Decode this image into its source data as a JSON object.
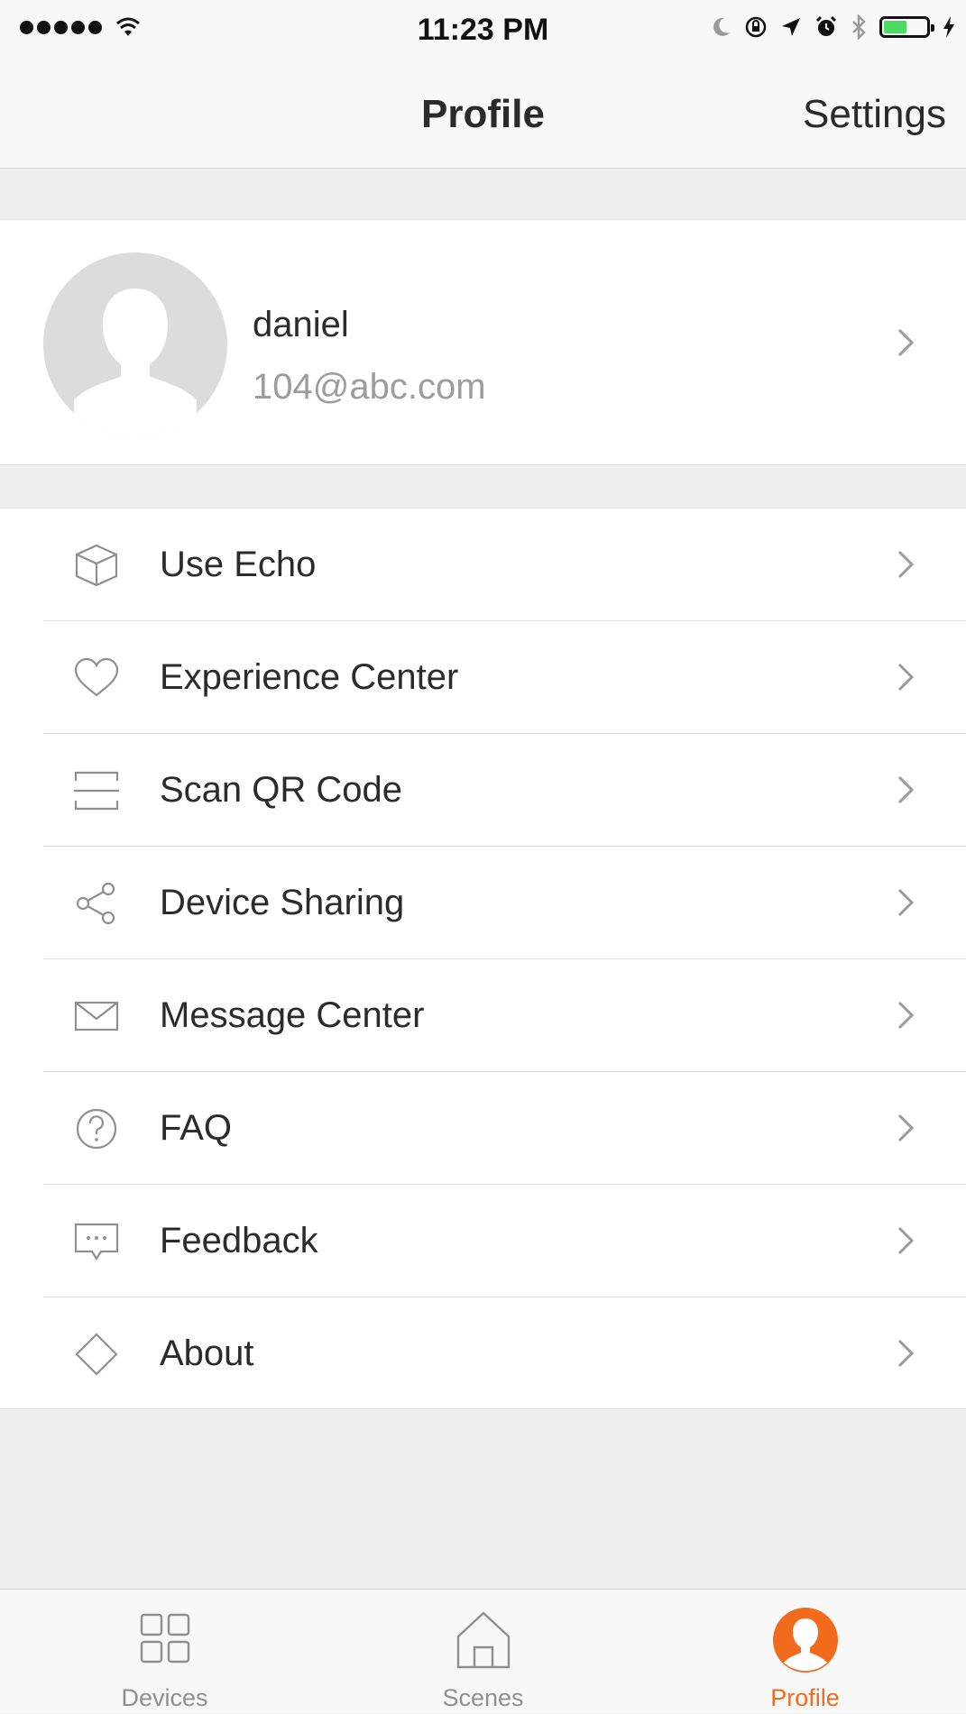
{
  "status_bar": {
    "time": "11:23 PM",
    "signal_bars": 5,
    "battery_level": 0.55
  },
  "nav": {
    "title": "Profile",
    "settings_label": "Settings"
  },
  "profile": {
    "name": "daniel",
    "email": "104@abc.com"
  },
  "menu": {
    "items": [
      {
        "icon": "cube-icon",
        "label": "Use Echo"
      },
      {
        "icon": "heart-icon",
        "label": "Experience Center"
      },
      {
        "icon": "scan-icon",
        "label": "Scan QR Code"
      },
      {
        "icon": "share-icon",
        "label": "Device Sharing"
      },
      {
        "icon": "envelope-icon",
        "label": "Message Center"
      },
      {
        "icon": "question-circle-icon",
        "label": "FAQ"
      },
      {
        "icon": "chat-bubble-icon",
        "label": "Feedback"
      },
      {
        "icon": "diamond-icon",
        "label": "About"
      }
    ]
  },
  "tab_bar": {
    "tabs": [
      {
        "icon": "grid-icon",
        "label": "Devices",
        "active": false
      },
      {
        "icon": "house-icon",
        "label": "Scenes",
        "active": false
      },
      {
        "icon": "person-icon",
        "label": "Profile",
        "active": true
      }
    ]
  },
  "colors": {
    "accent": "#f26b1d",
    "background": "#efefef",
    "text": "#2b2b2b",
    "muted_text": "#9c9c9c",
    "icon_gray": "#8f8f8f",
    "battery_green": "#4cd964"
  }
}
